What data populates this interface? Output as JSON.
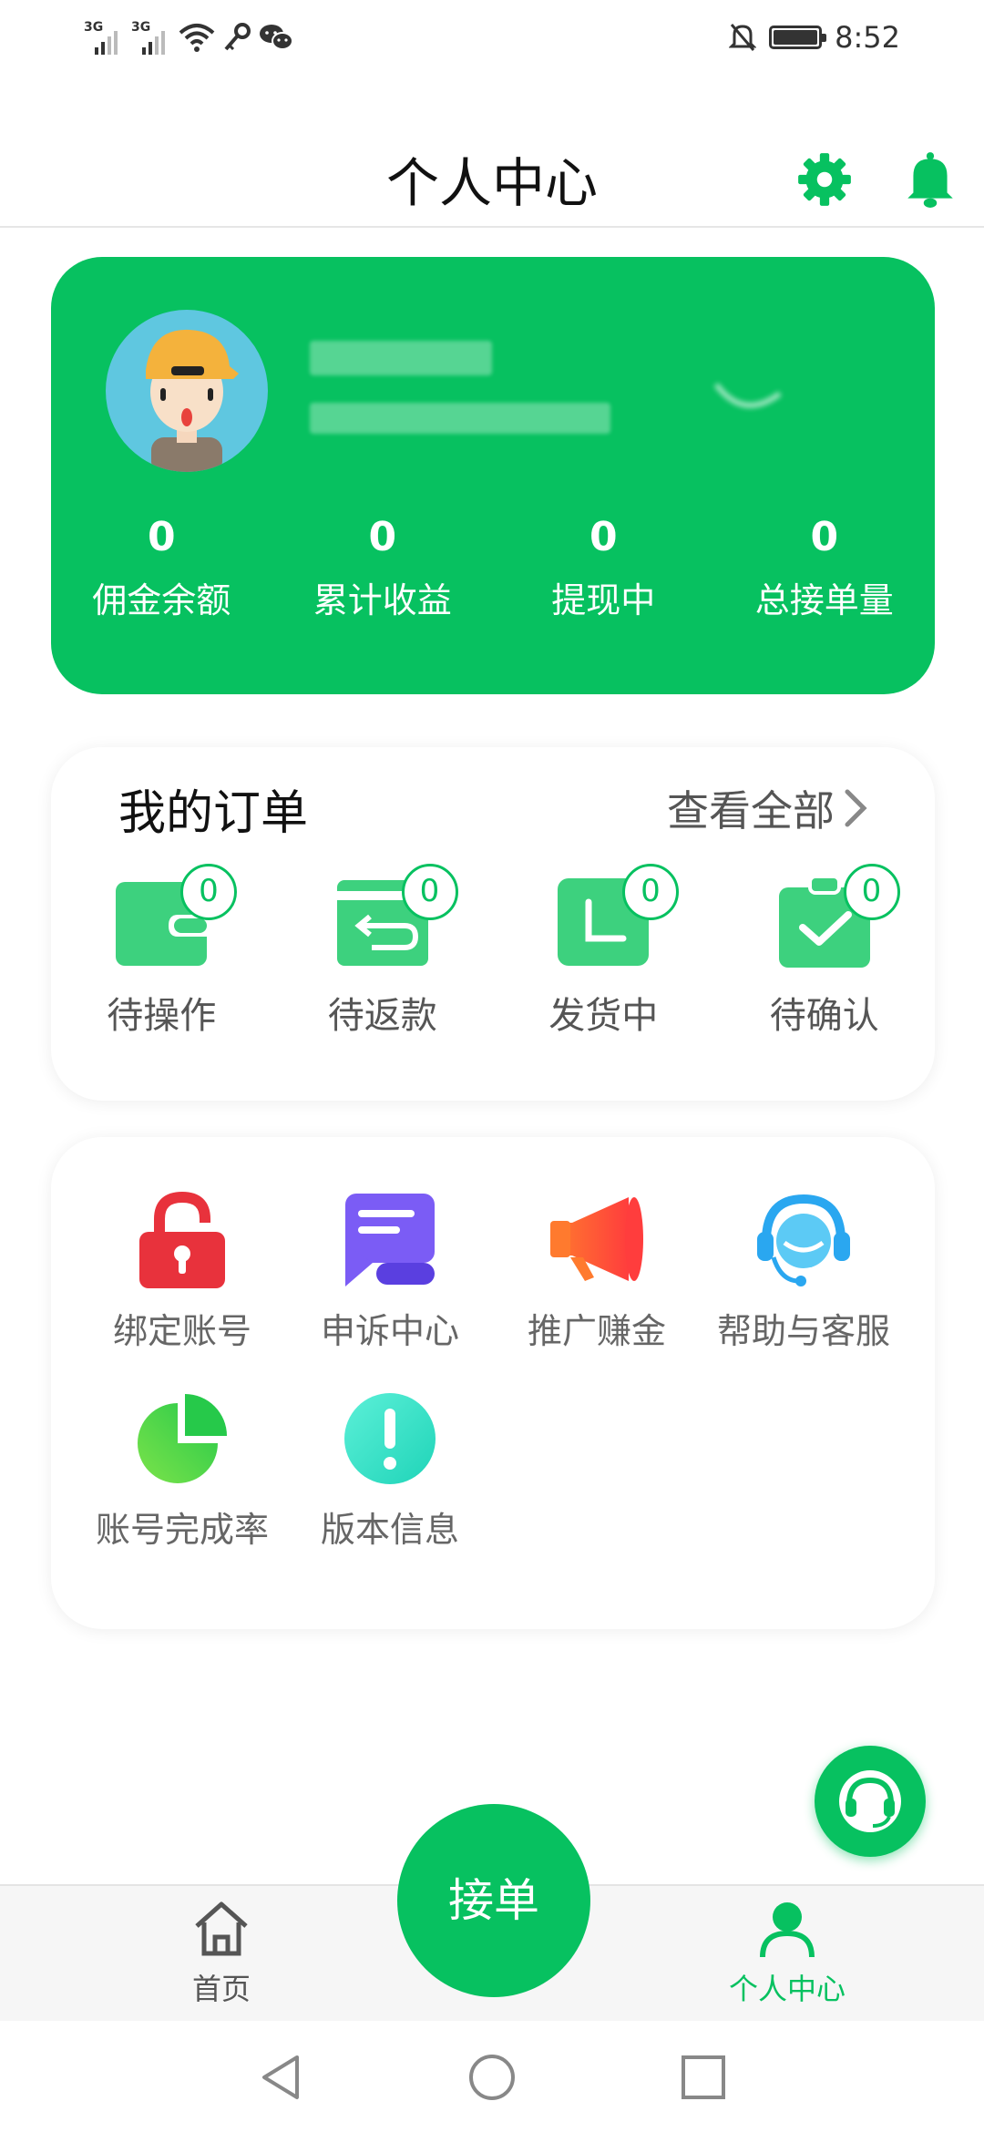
{
  "status_bar": {
    "network1": "3G",
    "network2": "3G",
    "time": "8:52"
  },
  "header": {
    "title": "个人中心"
  },
  "profile": {
    "stats": [
      {
        "value": "0",
        "label": "佣金余额"
      },
      {
        "value": "0",
        "label": "累计收益"
      },
      {
        "value": "0",
        "label": "提现中"
      },
      {
        "value": "0",
        "label": "总接单量"
      }
    ]
  },
  "orders": {
    "title": "我的订单",
    "view_all": "查看全部",
    "items": [
      {
        "label": "待操作",
        "count": "0",
        "icon": "wallet-icon"
      },
      {
        "label": "待返款",
        "count": "0",
        "icon": "refund-icon"
      },
      {
        "label": "发货中",
        "count": "0",
        "icon": "shipping-icon"
      },
      {
        "label": "待确认",
        "count": "0",
        "icon": "confirm-clipboard-icon"
      }
    ]
  },
  "services": {
    "items": [
      {
        "label": "绑定账号",
        "icon": "unlock-icon",
        "color": "#e8323c"
      },
      {
        "label": "申诉中心",
        "icon": "appeal-message-icon",
        "color": "#7b5cf5"
      },
      {
        "label": "推广赚金",
        "icon": "megaphone-icon",
        "color": "#ff5a36"
      },
      {
        "label": "帮助与客服",
        "icon": "headset-agent-icon",
        "color": "#2aa7f0"
      },
      {
        "label": "账号完成率",
        "icon": "pie-chart-icon",
        "color": "#3ccf4e"
      },
      {
        "label": "版本信息",
        "icon": "exclamation-icon",
        "color": "#2ee6c6"
      }
    ]
  },
  "bottom_nav": {
    "home_label": "首页",
    "take_order_label": "接单",
    "me_label": "个人中心"
  },
  "colors": {
    "accent": "#07c160"
  }
}
